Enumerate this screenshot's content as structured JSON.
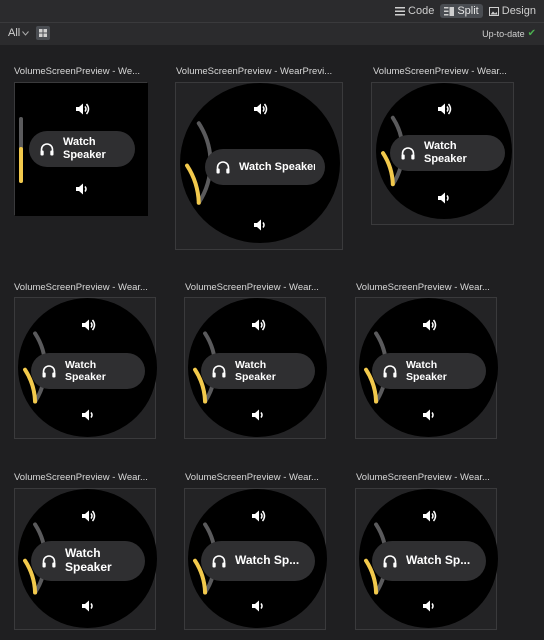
{
  "toolbar": {
    "code_label": "Code",
    "split_label": "Split",
    "design_label": "Design",
    "filter_label": "All",
    "status_label": "Up-to-date"
  },
  "colors": {
    "accent_fill": "#f2c94c",
    "track": "#5a5a5c",
    "chip": "#2f2f31"
  },
  "previews": [
    {
      "title": "VolumeScreenPreview - We...",
      "chip_lines": [
        "Watch",
        "Speaker"
      ]
    },
    {
      "title": "VolumeScreenPreview - WearPrevi...",
      "chip_lines": [
        "Watch Speaker"
      ]
    },
    {
      "title": "VolumeScreenPreview - Wear...",
      "chip_lines": [
        "Watch",
        "Speaker"
      ]
    },
    {
      "title": "VolumeScreenPreview - Wear...",
      "chip_lines": [
        "Watch",
        "Speaker"
      ]
    },
    {
      "title": "VolumeScreenPreview - Wear...",
      "chip_lines": [
        "Watch",
        "Speaker"
      ]
    },
    {
      "title": "VolumeScreenPreview - Wear...",
      "chip_lines": [
        "Watch",
        "Speaker"
      ]
    },
    {
      "title": "VolumeScreenPreview - Wear...",
      "chip_lines": [
        "Watch",
        "Speaker"
      ]
    },
    {
      "title": "VolumeScreenPreview - Wear...",
      "chip_lines": [
        "Watch Sp..."
      ]
    },
    {
      "title": "VolumeScreenPreview - Wear...",
      "chip_lines": [
        "Watch Sp..."
      ]
    }
  ]
}
